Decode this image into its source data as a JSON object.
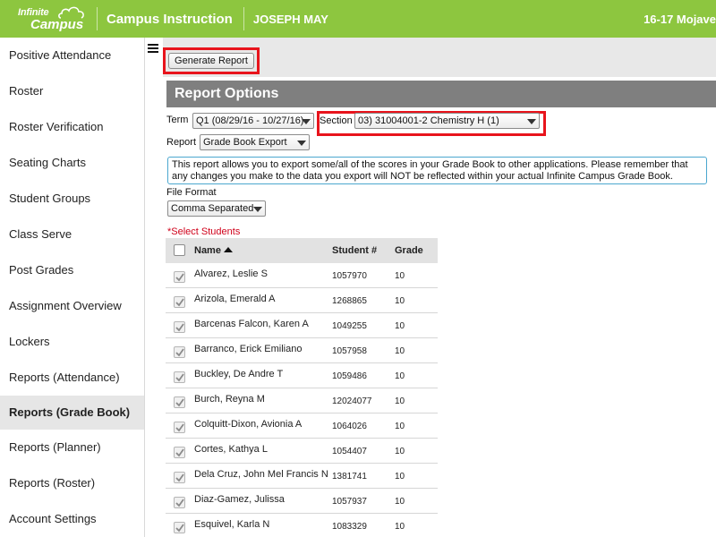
{
  "app": {
    "logo_line1": "Infinite",
    "logo_line2": "Campus",
    "title": "Campus Instruction",
    "user": "JOSEPH MAY",
    "school_year": "16-17 Mojave"
  },
  "sidebar": {
    "items": [
      {
        "label": "Positive Attendance"
      },
      {
        "label": "Roster"
      },
      {
        "label": "Roster Verification"
      },
      {
        "label": "Seating Charts"
      },
      {
        "label": "Student Groups"
      },
      {
        "label": "Class Serve"
      },
      {
        "label": "Post Grades"
      },
      {
        "label": "Assignment Overview"
      },
      {
        "label": "Lockers"
      },
      {
        "label": "Reports (Attendance)"
      },
      {
        "label": "Reports (Grade Book)"
      },
      {
        "label": "Reports (Planner)"
      },
      {
        "label": "Reports (Roster)"
      },
      {
        "label": "Account Settings"
      }
    ],
    "active_item": "Reports (Grade Book)"
  },
  "toolbar": {
    "generate_label": "Generate Report"
  },
  "options": {
    "title": "Report Options",
    "term_label": "Term",
    "term_value": "Q1 (08/29/16 - 10/27/16)",
    "section_label": "Section",
    "section_value": "03) 31004001-2 Chemistry H (1)",
    "report_label": "Report",
    "report_value": "Grade Book Export",
    "info_text": "This report allows you to export some/all of the scores in your Grade Book to other applications. Please remember that any changes you make to the data you export will NOT be reflected within your actual Infinite Campus Grade Book.",
    "file_format_label": "File Format",
    "file_format_value": "Comma Separated",
    "select_students_label": "*Select Students"
  },
  "table": {
    "headers": {
      "name": "Name",
      "student_num": "Student #",
      "grade": "Grade"
    },
    "sort": "ascending by name",
    "rows": [
      {
        "name": "Alvarez, Leslie S",
        "num": "1057970",
        "grade": "10",
        "checked": true
      },
      {
        "name": "Arizola, Emerald A",
        "num": "1268865",
        "grade": "10",
        "checked": true
      },
      {
        "name": "Barcenas Falcon, Karen A",
        "num": "1049255",
        "grade": "10",
        "checked": true
      },
      {
        "name": "Barranco, Erick Emiliano",
        "num": "1057958",
        "grade": "10",
        "checked": true
      },
      {
        "name": "Buckley, De Andre T",
        "num": "1059486",
        "grade": "10",
        "checked": true
      },
      {
        "name": "Burch, Reyna M",
        "num": "12024077",
        "grade": "10",
        "checked": true
      },
      {
        "name": "Colquitt-Dixon, Avionia A",
        "num": "1064026",
        "grade": "10",
        "checked": true
      },
      {
        "name": "Cortes, Kathya L",
        "num": "1054407",
        "grade": "10",
        "checked": true
      },
      {
        "name": "Dela Cruz, John Mel Francis N",
        "num": "1381741",
        "grade": "10",
        "checked": true
      },
      {
        "name": "Diaz-Gamez, Julissa",
        "num": "1057937",
        "grade": "10",
        "checked": true
      },
      {
        "name": "Esquivel, Karla N",
        "num": "1083329",
        "grade": "10",
        "checked": true
      }
    ]
  },
  "colors": {
    "brand_green": "#8dc63f",
    "header_gray": "#7f7f7f",
    "highlight_red": "#e8141c",
    "info_border": "#4ba7cf",
    "required_red": "#d0021b"
  }
}
